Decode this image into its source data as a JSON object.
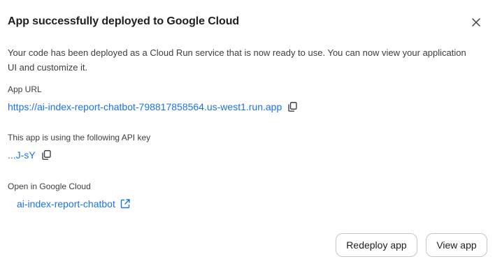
{
  "dialog": {
    "title": "App successfully deployed to Google Cloud",
    "description": "Your code has been deployed as a Cloud Run service that is now ready to use. You can now view your application UI and customize it.",
    "close_icon": "close-icon"
  },
  "app_url": {
    "label": "App URL",
    "value": "https://ai-index-report-chatbot-798817858564.us-west1.run.app",
    "copy_icon": "copy-icon"
  },
  "api_key": {
    "label": "This app is using the following API key",
    "value": "...J-sY",
    "copy_icon": "copy-icon"
  },
  "cloud": {
    "label": "Open in Google Cloud",
    "link_text": "ai-index-report-chatbot",
    "external_icon": "open-in-new-icon"
  },
  "actions": {
    "redeploy_label": "Redeploy app",
    "view_label": "View app"
  },
  "colors": {
    "link": "#1a73e8",
    "text": "#1f1f1f",
    "border": "#c4c7c5"
  }
}
